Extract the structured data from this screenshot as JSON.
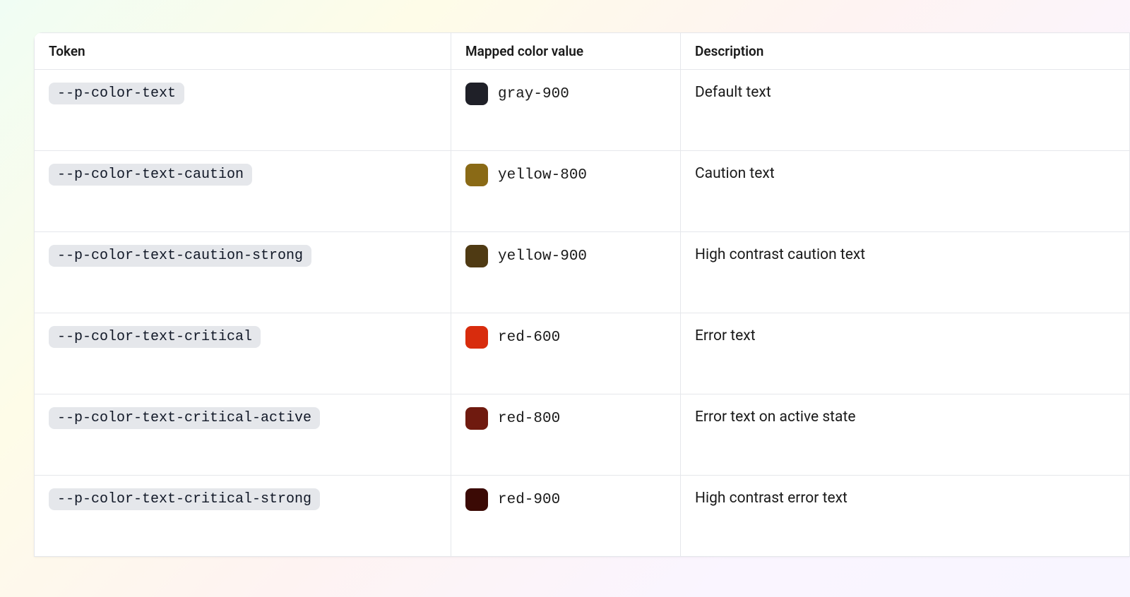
{
  "table": {
    "headers": {
      "token": "Token",
      "mapped": "Mapped color value",
      "description": "Description"
    },
    "rows": [
      {
        "token": "--p-color-text",
        "mapped_label": "gray-900",
        "swatch_hex": "#1f2028",
        "description": "Default text"
      },
      {
        "token": "--p-color-text-caution",
        "mapped_label": "yellow-800",
        "swatch_hex": "#8a6a16",
        "description": "Caution text"
      },
      {
        "token": "--p-color-text-caution-strong",
        "mapped_label": "yellow-900",
        "swatch_hex": "#4f3a13",
        "description": "High contrast caution text"
      },
      {
        "token": "--p-color-text-critical",
        "mapped_label": "red-600",
        "swatch_hex": "#d82c0d",
        "description": "Error text"
      },
      {
        "token": "--p-color-text-critical-active",
        "mapped_label": "red-800",
        "swatch_hex": "#6f1a0f",
        "description": "Error text on active state"
      },
      {
        "token": "--p-color-text-critical-strong",
        "mapped_label": "red-900",
        "swatch_hex": "#3b0a05",
        "description": "High contrast error text"
      }
    ]
  }
}
